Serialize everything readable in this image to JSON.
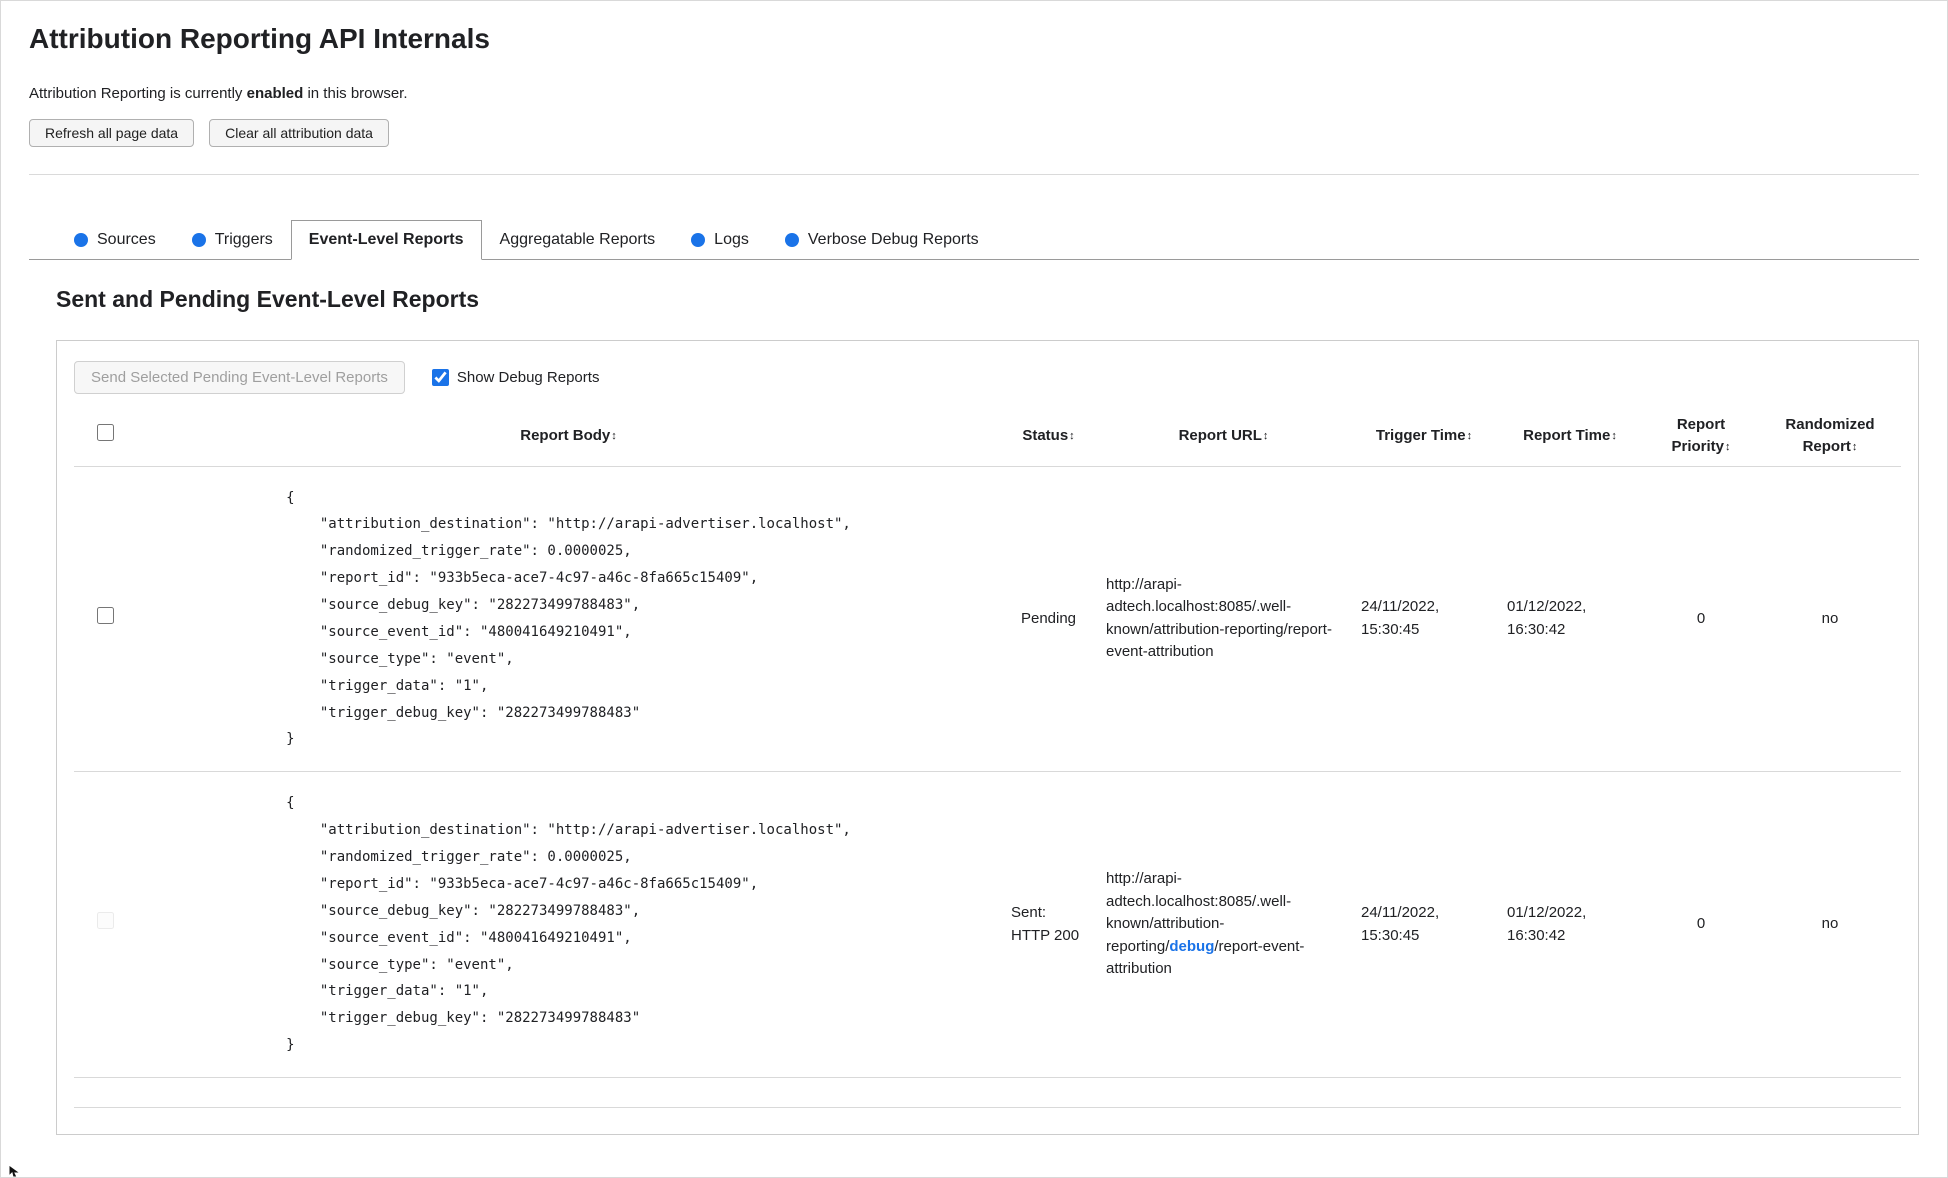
{
  "page": {
    "title": "Attribution Reporting API Internals",
    "status": {
      "prefix": "Attribution Reporting is currently ",
      "bold": "enabled",
      "suffix": " in this browser."
    },
    "buttons": {
      "refresh": "Refresh all page data",
      "clear": "Clear all attribution data"
    }
  },
  "colors": {
    "accent_blue": "#1a73e8"
  },
  "tabs": [
    {
      "label": "Sources",
      "has_dot": true,
      "active": false
    },
    {
      "label": "Triggers",
      "has_dot": true,
      "active": false
    },
    {
      "label": "Event-Level Reports",
      "has_dot": false,
      "active": true
    },
    {
      "label": "Aggregatable Reports",
      "has_dot": false,
      "active": false
    },
    {
      "label": "Logs",
      "has_dot": true,
      "active": false
    },
    {
      "label": "Verbose Debug Reports",
      "has_dot": true,
      "active": false
    }
  ],
  "section": {
    "heading": "Sent and Pending Event-Level Reports",
    "send_button": "Send Selected Pending Event-Level Reports",
    "show_debug_label": "Show Debug Reports"
  },
  "table": {
    "sort_glyph": "↕",
    "headers": {
      "report_body": "Report Body",
      "status": "Status",
      "report_url": "Report URL",
      "trigger_time": "Trigger Time",
      "report_time": "Report Time",
      "report_priority": "Report Priority",
      "randomized_report": "Randomized Report"
    },
    "rows": [
      {
        "report_body": "{\n    \"attribution_destination\": \"http://arapi-advertiser.localhost\",\n    \"randomized_trigger_rate\": 0.0000025,\n    \"report_id\": \"933b5eca-ace7-4c97-a46c-8fa665c15409\",\n    \"source_debug_key\": \"282273499788483\",\n    \"source_event_id\": \"480041649210491\",\n    \"source_type\": \"event\",\n    \"trigger_data\": \"1\",\n    \"trigger_debug_key\": \"282273499788483\"\n}",
        "status": "Pending",
        "url_prefix": "http://arapi-adtech.localhost:8085/.well-known/attribution-reporting/",
        "url_debug": "",
        "url_suffix": "report-event-attribution",
        "trigger_time": "24/11/2022, 15:30:45",
        "report_time": "01/12/2022, 16:30:42",
        "report_priority": "0",
        "randomized_report": "no"
      },
      {
        "report_body": "{\n    \"attribution_destination\": \"http://arapi-advertiser.localhost\",\n    \"randomized_trigger_rate\": 0.0000025,\n    \"report_id\": \"933b5eca-ace7-4c97-a46c-8fa665c15409\",\n    \"source_debug_key\": \"282273499788483\",\n    \"source_event_id\": \"480041649210491\",\n    \"source_type\": \"event\",\n    \"trigger_data\": \"1\",\n    \"trigger_debug_key\": \"282273499788483\"\n}",
        "status": "Sent: HTTP 200",
        "url_prefix": "http://arapi-adtech.localhost:8085/.well-known/attribution-reporting/",
        "url_debug": "debug",
        "url_suffix": "/report-event-attribution",
        "trigger_time": "24/11/2022, 15:30:45",
        "report_time": "01/12/2022, 16:30:42",
        "report_priority": "0",
        "randomized_report": "no"
      }
    ]
  }
}
